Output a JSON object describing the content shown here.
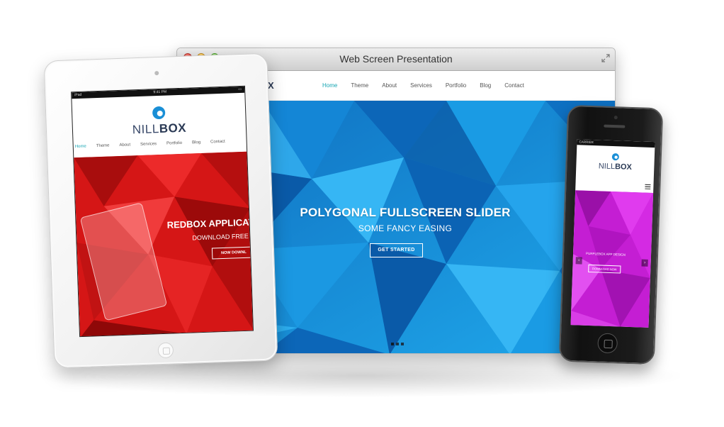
{
  "browser": {
    "title": "Web Screen Presentation",
    "site": {
      "logo": "X",
      "nav": [
        "Home",
        "Theme",
        "About",
        "Services",
        "Portfolio",
        "Blog",
        "Contact"
      ],
      "active_nav": "Home"
    },
    "hero": {
      "title": "POLYGONAL FULLSCREEN SLIDER",
      "subtitle": "SOME FANCY EASING",
      "button": "GET STARTED",
      "slide_count": 3,
      "active_slide": 1
    },
    "colors": {
      "accent": "#16a5b3",
      "hero_bg": "#1b90d8"
    }
  },
  "tablet": {
    "status_time": "9:41 PM",
    "logo_thin": "NILL",
    "logo_bold": "BOX",
    "nav": [
      "Home",
      "Theme",
      "About",
      "Services",
      "Portfolio",
      "Blog",
      "Contact"
    ],
    "hero": {
      "title": "REDBOX APPLICAT",
      "subtitle": "DOWNLOAD FREE",
      "button": "NOW DOWNL"
    },
    "colors": {
      "hero_bg": "#d51616"
    }
  },
  "phone": {
    "status_carrier": "CARRIER",
    "logo_thin": "NILL",
    "logo_bold": "BOX",
    "hero": {
      "title": "PURPLEBOX APP DESIGN",
      "button": "DOWNLOAD NOW"
    },
    "colors": {
      "hero_bg": "#c41ed3"
    }
  }
}
